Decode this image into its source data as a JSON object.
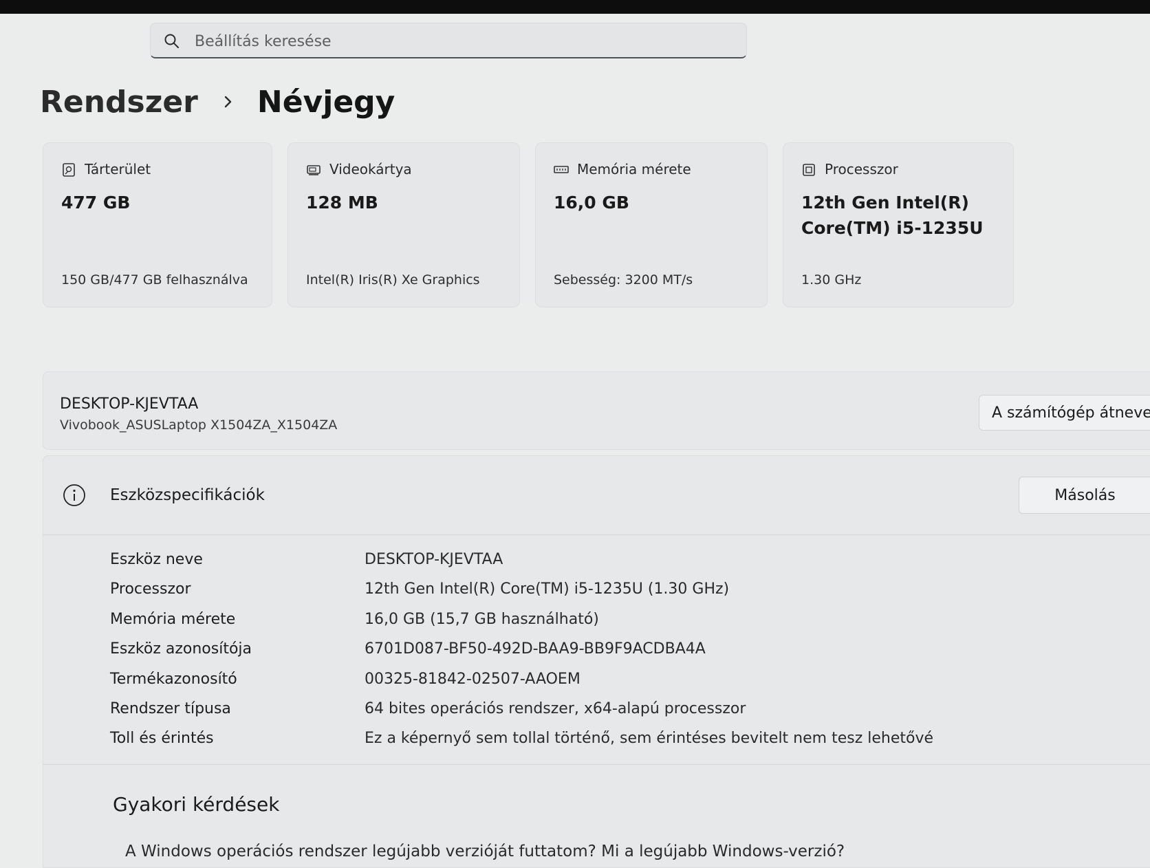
{
  "search": {
    "placeholder": "Beállítás keresése"
  },
  "breadcrumb": {
    "parent": "Rendszer",
    "current": "Névjegy"
  },
  "cards": [
    {
      "icon": "storage-icon",
      "label": "Tárterület",
      "value": "477 GB",
      "detail": "150 GB/477 GB felhasználva"
    },
    {
      "icon": "graphics-card-icon",
      "label": "Videokártya",
      "value": "128 MB",
      "detail": "Intel(R) Iris(R) Xe Graphics"
    },
    {
      "icon": "memory-icon",
      "label": "Memória mérete",
      "value": "16,0 GB",
      "detail": "Sebesség: 3200 MT/s"
    },
    {
      "icon": "processor-icon",
      "label": "Processzor",
      "value": "12th Gen Intel(R) Core(TM) i5-1235U",
      "detail": "1.30 GHz"
    }
  ],
  "device": {
    "name": "DESKTOP-KJEVTAA",
    "model": "Vivobook_ASUSLaptop X1504ZA_X1504ZA",
    "rename_label": "A számítógép átnevez"
  },
  "specs": {
    "title": "Eszközspecifikációk",
    "copy_label": "Másolás",
    "rows": [
      {
        "key": "Eszköz neve",
        "value": "DESKTOP-KJEVTAA"
      },
      {
        "key": "Processzor",
        "value": "12th Gen Intel(R) Core(TM) i5-1235U (1.30 GHz)"
      },
      {
        "key": "Memória mérete",
        "value": "16,0 GB (15,7 GB használható)"
      },
      {
        "key": "Eszköz azonosítója",
        "value": "6701D087-BF50-492D-BAA9-BB9F9ACDBA4A"
      },
      {
        "key": "Termékazonosító",
        "value": "00325-81842-02507-AAOEM"
      },
      {
        "key": "Rendszer típusa",
        "value": "64 bites operációs rendszer, x64-alapú processzor"
      },
      {
        "key": "Toll és érintés",
        "value": "Ez a képernyő sem tollal történő, sem érintéses bevitelt nem tesz lehetővé"
      }
    ]
  },
  "faq": {
    "title": "Gyakori kérdések",
    "question": "A Windows operációs rendszer legújabb verzióját futtatom? Mi a legújabb Windows-verzió?"
  }
}
